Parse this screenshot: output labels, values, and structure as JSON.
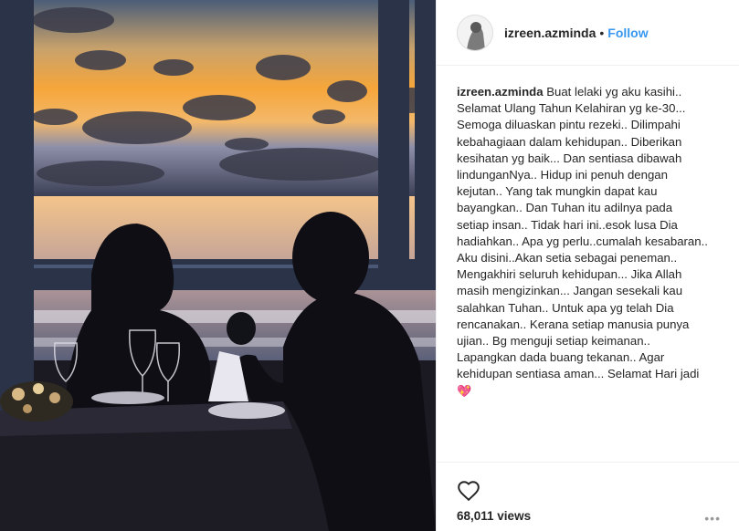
{
  "post": {
    "username": "izreen.azminda",
    "separator": "•",
    "follow_label": "Follow",
    "caption_user": "izreen.azminda",
    "caption_lines": [
      "Buat lelaki yg aku kasihi..",
      "Selamat Ulang Tahun Kelahiran yg ke-30...",
      "Semoga diluaskan pintu rezeki.. Dilimpahi",
      "kebahagiaan dalam kehidupan.. Diberikan",
      "kesihatan yg baik... Dan sentiasa dibawah",
      "lindunganNya.. Hidup ini penuh dengan",
      "kejutan.. Yang tak mungkin dapat kau",
      "bayangkan.. Dan Tuhan itu adilnya pada",
      "setiap insan.. Tidak hari ini..esok lusa Dia",
      "hadiahkan.. Apa yg perlu..cumalah kesabaran..",
      "Aku disini..Akan setia sebagai peneman..",
      "Mengakhiri seluruh kehidupan... Jika Allah",
      "masih mengizinkan... Jangan sesekali kau",
      "salahkan Tuhan.. Untuk apa yg telah Dia",
      "rencanakan.. Kerana setiap manusia punya",
      "ujian.. Bg menguji setiap keimanan..",
      "Lapangkan dada buang tekanan.. Agar",
      "kehidupan sentiasa aman... Selamat Hari jadi"
    ],
    "caption_emoji": "💖",
    "views": "68,011 views",
    "more_label": "•••"
  },
  "icons": {
    "heart": "heart-icon",
    "more": "more-options-icon",
    "avatar": "avatar"
  },
  "colors": {
    "link": "#3897f0",
    "text": "#262626",
    "divider": "#efefef"
  }
}
